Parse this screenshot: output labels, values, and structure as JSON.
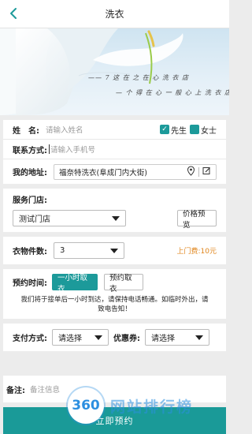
{
  "header": {
    "title": "洗衣"
  },
  "banner": {
    "line1": "—— 7 这 在 之 在 心 洗 衣 店",
    "line2": "— 个 得 在 心 一 般 心 上 洗 衣 店"
  },
  "form": {
    "name_label": "姓　名:",
    "name_placeholder": "请输入姓名",
    "gender_male": "先生",
    "gender_female": "女士",
    "contact_label": "联系方式:",
    "contact_placeholder": "请输入手机号",
    "address_label": "我的地址:",
    "address_value": "福奈特洗衣(阜成门内大街)"
  },
  "store": {
    "label": "服务门店:",
    "selected": "测试门店",
    "price_button": "价格预览"
  },
  "items": {
    "label": "衣物件数:",
    "value": "3",
    "fee": "上门费:10元"
  },
  "booking": {
    "label": "预约时间:",
    "option_one_hour": "一小时取衣",
    "option_schedule": "预约取衣",
    "notice": "我们将于接单后一小时到达，请保持电话畅通。如临时外出，请致电告知！"
  },
  "payment": {
    "pay_label": "支付方式:",
    "pay_selected": "请选择",
    "coupon_label": "优惠券:",
    "coupon_selected": "请选择"
  },
  "remarks": {
    "label": "备注:",
    "placeholder": "备注信息"
  },
  "submit_label": "立即预约",
  "watermark": {
    "logo": "360",
    "text": "网站排行榜"
  },
  "colors": {
    "accent": "#1c9a9a",
    "fee": "#e0861d"
  }
}
